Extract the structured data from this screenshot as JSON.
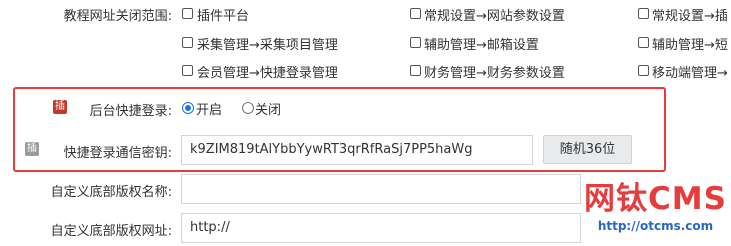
{
  "close_range": {
    "label": "教程网址关闭范围:",
    "options": [
      "插件平台",
      "常规设置→网站参数设置",
      "常规设置→插",
      "采集管理→采集项目管理",
      "辅助管理→邮箱设置",
      "辅助管理→短",
      "会员管理→快捷登录管理",
      "财务管理→财务参数设置",
      "移动端管理→"
    ]
  },
  "quick_login": {
    "plugin_icon": "插",
    "label": "后台快捷登录:",
    "option_on": "开启",
    "option_off": "关闭",
    "selected": "开启"
  },
  "secret_key": {
    "plugin_icon": "插",
    "label": "快捷登录通信密钥:",
    "value": "k9ZIM819tAlYbbYywRT3qrRfRaSj7PP5haWg",
    "random_button": "随机36位"
  },
  "copyright_name": {
    "label": "自定义底部版权名称:",
    "value": ""
  },
  "copyright_url": {
    "label": "自定义底部版权网址:",
    "value": "http://"
  },
  "watermark": {
    "title": "网钛CMS",
    "url": "http://otcms.com"
  },
  "colors": {
    "highlight_border": "#e63c3c",
    "plugin_icon_red": "#c0392b",
    "plugin_icon_gray": "#9a9a9a",
    "radio_accent": "#1a73e8",
    "watermark_red": "#e63c3c",
    "watermark_blue": "#2b66c4"
  }
}
